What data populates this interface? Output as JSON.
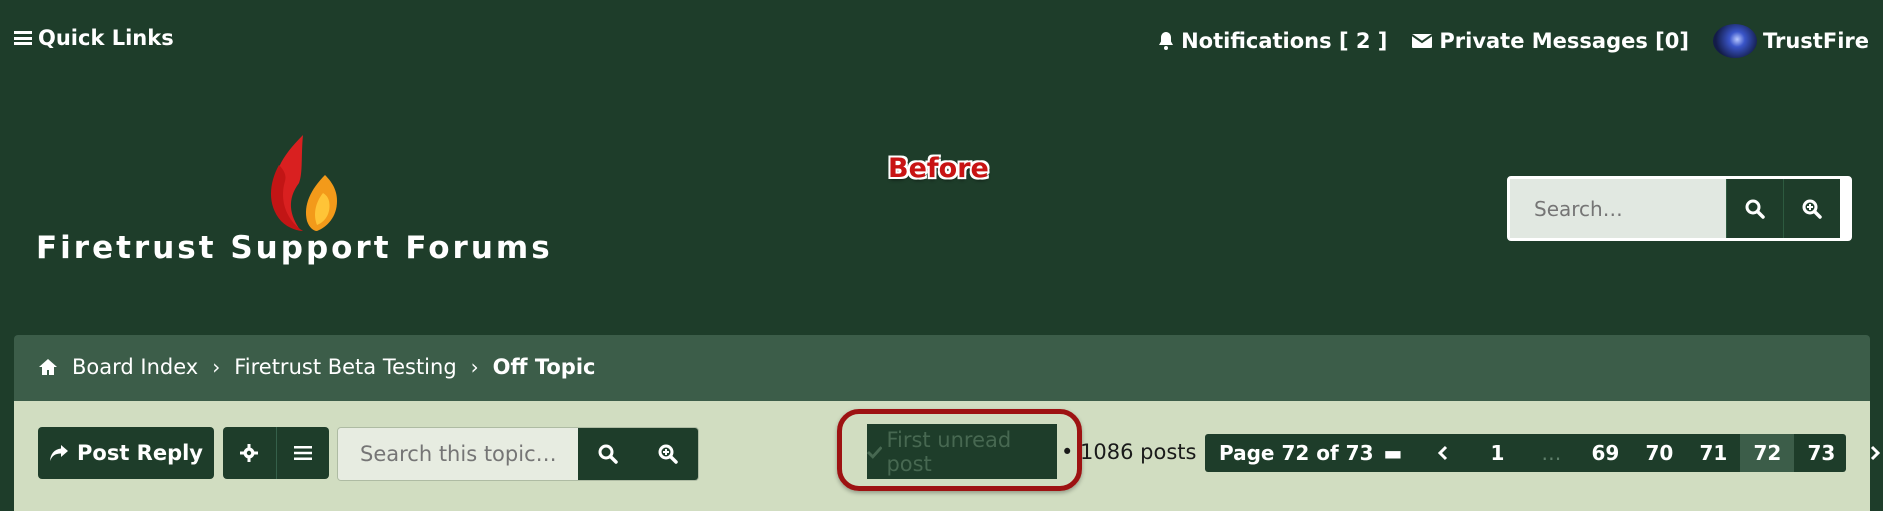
{
  "topbar": {
    "quick_links": "Quick Links",
    "notifications": "Notifications [ 2 ]",
    "messages": "Private Messages [0]",
    "username": "TrustFire"
  },
  "header": {
    "site_title": "Firetrust Support Forums",
    "annotation": "Before",
    "search_placeholder": "Search…"
  },
  "breadcrumb": {
    "items": [
      "Board Index",
      "Firetrust Beta Testing",
      "Off Topic"
    ]
  },
  "actions": {
    "post_reply": "Post Reply",
    "topic_search_placeholder": "Search this topic…",
    "first_unread": "First unread post",
    "posts_count": "• 1086 posts"
  },
  "pagination": {
    "label": "Page 72 of 73",
    "pages": [
      "1",
      "…",
      "69",
      "70",
      "71",
      "72",
      "73"
    ],
    "current": "72"
  },
  "colors": {
    "header_bg": "#1e3d2a",
    "breadcrumb_bg": "#3c5d49",
    "content_bg": "#d1ddc1",
    "highlight_ring": "#9d1212"
  }
}
